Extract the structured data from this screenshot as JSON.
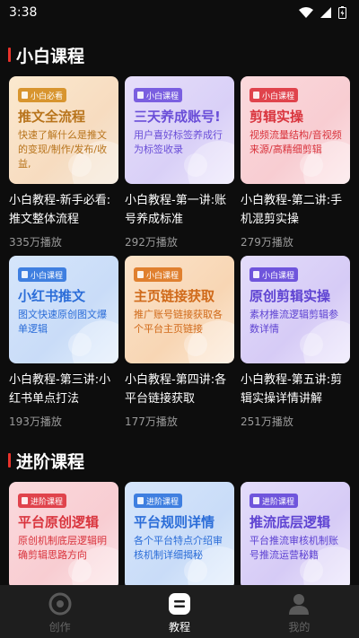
{
  "status_bar": {
    "time": "3:38"
  },
  "sections": [
    {
      "title": "小白课程",
      "cards": [
        {
          "theme": "peach",
          "tag": "小白必看",
          "thumb_title": "推文全流程",
          "thumb_desc": "快速了解什么是推文的变现/制作/发布/收益,",
          "title": "小白教程-新手必看:推文整体流程",
          "views": "335万播放"
        },
        {
          "theme": "lavender",
          "tag": "小白课程",
          "thumb_title": "三天养成账号!",
          "thumb_desc": "用户喜好标签养成行为标签收录",
          "title": "小白教程-第一讲:账号养成标准",
          "views": "292万播放"
        },
        {
          "theme": "pink",
          "tag": "小白课程",
          "thumb_title": "剪辑实操",
          "thumb_desc": "视频流量结构/音视频来源/高精细剪辑",
          "title": "小白教程-第二讲:手机混剪实操",
          "views": "279万播放"
        },
        {
          "theme": "blue",
          "tag": "小白课程",
          "thumb_title": "小红书推文",
          "thumb_desc": "图文快速原创图文爆单逻辑",
          "title": "小白教程-第三讲:小红书单点打法",
          "views": "193万播放"
        },
        {
          "theme": "orange",
          "tag": "小白课程",
          "thumb_title": "主页链接获取",
          "thumb_desc": "推广账号链接获取各个平台主页链接",
          "title": "小白教程-第四讲:各平台链接获取",
          "views": "177万播放"
        },
        {
          "theme": "violet",
          "tag": "小白课程",
          "thumb_title": "原创剪辑实操",
          "thumb_desc": "素材推流逻辑剪辑参数详情",
          "title": "小白教程-第五讲:剪辑实操详情讲解",
          "views": "251万播放"
        }
      ]
    },
    {
      "title": "进阶课程",
      "cards": [
        {
          "theme": "pink",
          "tag": "进阶课程",
          "thumb_title": "平台原创逻辑",
          "thumb_desc": "原创机制底层逻辑明确剪辑思路方向",
          "title": "",
          "views": ""
        },
        {
          "theme": "blue",
          "tag": "进阶课程",
          "thumb_title": "平台规则详情",
          "thumb_desc": "各个平台特点介绍审核机制详细揭秘",
          "title": "",
          "views": ""
        },
        {
          "theme": "violet",
          "tag": "进阶课程",
          "thumb_title": "推流底层逻辑",
          "thumb_desc": "平台推流审核机制账号推流运营秘籍",
          "title": "",
          "views": ""
        }
      ]
    }
  ],
  "tab_bar": {
    "tabs": [
      {
        "label": "创作",
        "icon": "disc-icon",
        "active": false
      },
      {
        "label": "教程",
        "icon": "tutorial-icon",
        "active": true
      },
      {
        "label": "我的",
        "icon": "person-icon",
        "active": false
      }
    ]
  }
}
